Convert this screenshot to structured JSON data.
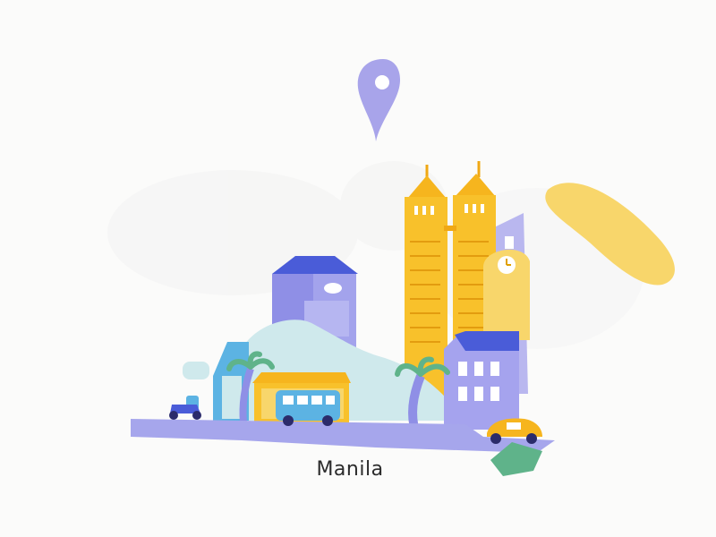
{
  "city": {
    "name": "Manila"
  },
  "icons": {
    "pin": "location-pin-icon"
  },
  "palette": {
    "background": "#fbfbfa",
    "yellow": "#f6b51e",
    "light_yellow": "#f8d66b",
    "purple": "#8f8fe6",
    "deep_blue": "#4a5cd8",
    "light_teal": "#cfe9ec",
    "sky_blue": "#5cb3e3",
    "green": "#5fb38a",
    "road": "#a6a6ec"
  }
}
